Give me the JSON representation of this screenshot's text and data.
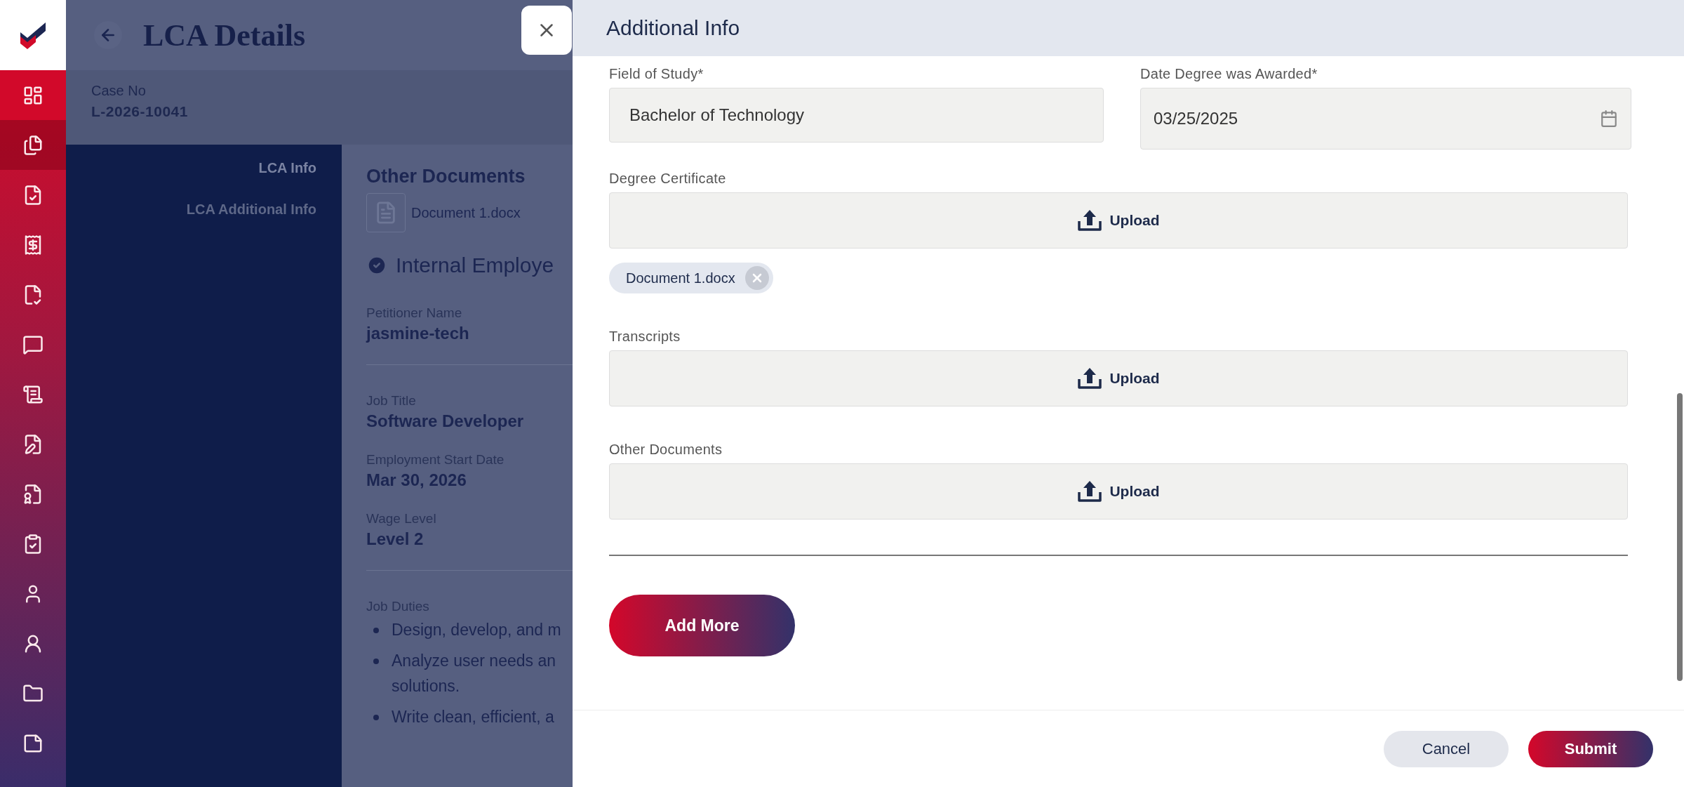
{
  "sidebar": {
    "items": [
      {
        "selected": false
      },
      {
        "selected": true
      },
      {
        "selected": false
      },
      {
        "selected": false
      },
      {
        "selected": false
      },
      {
        "selected": false
      },
      {
        "selected": false
      },
      {
        "selected": false
      },
      {
        "selected": false
      },
      {
        "selected": false
      },
      {
        "selected": false
      },
      {
        "selected": false
      },
      {
        "selected": false
      },
      {
        "selected": false
      }
    ]
  },
  "page": {
    "title": "LCA Details",
    "case": {
      "label": "Case No",
      "value": "L-2026-10041"
    },
    "nav": [
      {
        "label": "LCA Info",
        "selected": true
      },
      {
        "label": "LCA Additional Info",
        "selected": false
      }
    ],
    "documents": {
      "title": "Other Documents",
      "files": [
        {
          "name": "Document 1.docx"
        }
      ]
    },
    "section": {
      "title": "Internal Employe",
      "verified": true
    },
    "details": [
      {
        "label": "Petitioner Name",
        "value": "jasmine-tech"
      },
      {
        "label": "Job Title",
        "value": "Software Developer"
      },
      {
        "label": "Employment Start Date",
        "value": "Mar 30, 2026"
      },
      {
        "label": "Wage Level",
        "value": "Level 2"
      }
    ],
    "duties": {
      "label": "Job Duties",
      "items": [
        {
          "lines": [
            "Design, develop, and m"
          ]
        },
        {
          "lines": [
            "Analyze user needs an",
            "solutions."
          ]
        },
        {
          "lines": [
            "Write clean, efficient, a"
          ]
        }
      ]
    }
  },
  "drawer": {
    "title": "Additional Info",
    "fields": [
      {
        "kind": "text",
        "label": "Field of Study*",
        "value": "Bachelor of Technology"
      },
      {
        "kind": "date",
        "label": "Date Degree was Awarded*",
        "value": "03/25/2025"
      }
    ],
    "uploads": [
      {
        "label": "Degree Certificate",
        "button": "Upload",
        "files": [
          {
            "name": "Document 1.docx"
          }
        ]
      },
      {
        "label": "Transcripts",
        "button": "Upload"
      },
      {
        "label": "Other Documents",
        "button": "Upload"
      }
    ],
    "add_more": "Add More",
    "footer": [
      {
        "kind": "secondary",
        "label": "Cancel"
      },
      {
        "kind": "primary",
        "label": "Submit"
      }
    ]
  }
}
